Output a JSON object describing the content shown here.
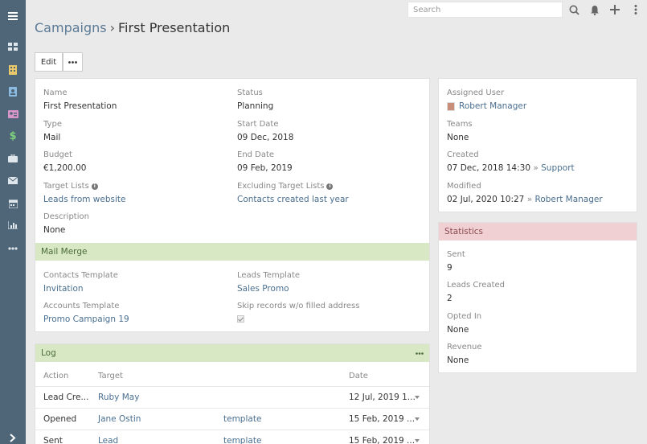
{
  "search": {
    "placeholder": "Search"
  },
  "breadcrumb": {
    "parent": "Campaigns",
    "separator": "›",
    "current": "First Presentation"
  },
  "actions": {
    "edit_label": "Edit"
  },
  "details": {
    "name_label": "Name",
    "name_value": "First Presentation",
    "status_label": "Status",
    "status_value": "Planning",
    "type_label": "Type",
    "type_value": "Mail",
    "start_label": "Start Date",
    "start_value": "09 Dec, 2018",
    "budget_label": "Budget",
    "budget_value": "€1,200.00",
    "end_label": "End Date",
    "end_value": "09 Feb, 2019",
    "target_lists_label": "Target Lists",
    "target_lists_value": "Leads from website",
    "excl_lists_label": "Excluding Target Lists",
    "excl_lists_value": "Contacts created last year",
    "description_label": "Description",
    "description_value": "None"
  },
  "mail_merge": {
    "title": "Mail Merge",
    "contacts_label": "Contacts Template",
    "contacts_value": "Invitation",
    "leads_label": "Leads Template",
    "leads_value": "Sales Promo",
    "accounts_label": "Accounts Template",
    "accounts_value": "Promo Campaign 19",
    "skip_label": "Skip records w/o filled address",
    "skip_checked": true
  },
  "log": {
    "title": "Log",
    "columns": {
      "action": "Action",
      "target": "Target",
      "date": "Date"
    },
    "rows": [
      {
        "action": "Lead Cre...",
        "target": "Ruby May",
        "template": "",
        "date": "12 Jul, 2019 1..."
      },
      {
        "action": "Opened",
        "target": "Jane Ostin",
        "template": "template",
        "date": "15 Feb, 2019 ..."
      },
      {
        "action": "Sent",
        "target": "Lead",
        "template": "template",
        "date": "15 Feb, 2019 ..."
      }
    ]
  },
  "side": {
    "assigned_label": "Assigned User",
    "assigned_value": "Robert Manager",
    "teams_label": "Teams",
    "teams_value": "None",
    "created_label": "Created",
    "created_date": "07 Dec, 2018 14:30",
    "created_by_sep": "»",
    "created_by": "Support",
    "modified_label": "Modified",
    "modified_date": "02 Jul, 2020 10:27",
    "modified_by_sep": "»",
    "modified_by": "Robert Manager"
  },
  "statistics": {
    "title": "Statistics",
    "sent_label": "Sent",
    "sent_value": "9",
    "leads_label": "Leads Created",
    "leads_value": "2",
    "opted_label": "Opted In",
    "opted_value": "None",
    "revenue_label": "Revenue",
    "revenue_value": "None"
  },
  "sidebar_icons": [
    "menu-icon",
    "dashboard-icon",
    "building-icon",
    "contact-book-icon",
    "id-card-icon",
    "dollar-icon",
    "briefcase-icon",
    "envelope-icon",
    "calendar-icon",
    "chart-icon",
    "more-icon",
    "chevron-right-icon"
  ],
  "colors": {
    "sidebar": "#4e6677",
    "accent_green": "#d8e8c4",
    "accent_red": "#f0d0d3",
    "link": "#4a6f90"
  }
}
